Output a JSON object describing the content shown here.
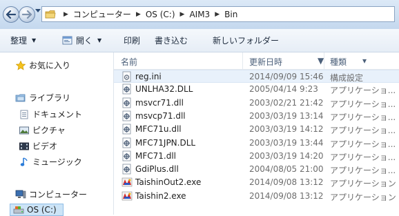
{
  "address": {
    "breadcrumb": [
      "コンピューター",
      "OS (C:)",
      "AIM3",
      "Bin"
    ]
  },
  "toolbar": {
    "organize": "整理",
    "open": "開く",
    "print": "印刷",
    "burn": "書き込む",
    "new_folder": "新しいフォルダー"
  },
  "nav": {
    "favorites": "お気に入り",
    "libraries": "ライブラリ",
    "documents": "ドキュメント",
    "pictures": "ピクチャ",
    "videos": "ビデオ",
    "music": "ミュージック",
    "computer": "コンピューター",
    "drive": "OS (C:)"
  },
  "columns": {
    "name": "名前",
    "date": "更新日時",
    "type": "種類"
  },
  "files": [
    {
      "name": "reg.ini",
      "date": "2014/09/09 15:46",
      "type": "構成設定",
      "icon": "ini-file-icon"
    },
    {
      "name": "UNLHA32.DLL",
      "date": "2005/04/14 9:23",
      "type": "アプリケーショ...",
      "icon": "dll-file-icon"
    },
    {
      "name": "msvcr71.dll",
      "date": "2003/02/21 21:42",
      "type": "アプリケーショ...",
      "icon": "dll-file-icon"
    },
    {
      "name": "msvcp71.dll",
      "date": "2003/03/19 13:14",
      "type": "アプリケーショ...",
      "icon": "dll-file-icon"
    },
    {
      "name": "MFC71u.dll",
      "date": "2003/03/19 14:12",
      "type": "アプリケーショ...",
      "icon": "dll-file-icon"
    },
    {
      "name": "MFC71JPN.DLL",
      "date": "2003/03/19 13:44",
      "type": "アプリケーショ...",
      "icon": "dll-file-icon"
    },
    {
      "name": "MFC71.dll",
      "date": "2003/03/19 14:20",
      "type": "アプリケーショ...",
      "icon": "dll-file-icon"
    },
    {
      "name": "GdiPlus.dll",
      "date": "2004/08/05 21:00",
      "type": "アプリケーショ...",
      "icon": "dll-file-icon"
    },
    {
      "name": "TaishinOut2.exe",
      "date": "2014/09/08 13:12",
      "type": "アプリケーション",
      "icon": "exe-app-icon"
    },
    {
      "name": "Taishin2.exe",
      "date": "2014/09/08 13:12",
      "type": "アプリケーション",
      "icon": "exe-app-icon"
    }
  ],
  "colors": {
    "selection": "#cce4f7",
    "header_text": "#4c607a",
    "secondary_text": "#6d6d6d"
  }
}
